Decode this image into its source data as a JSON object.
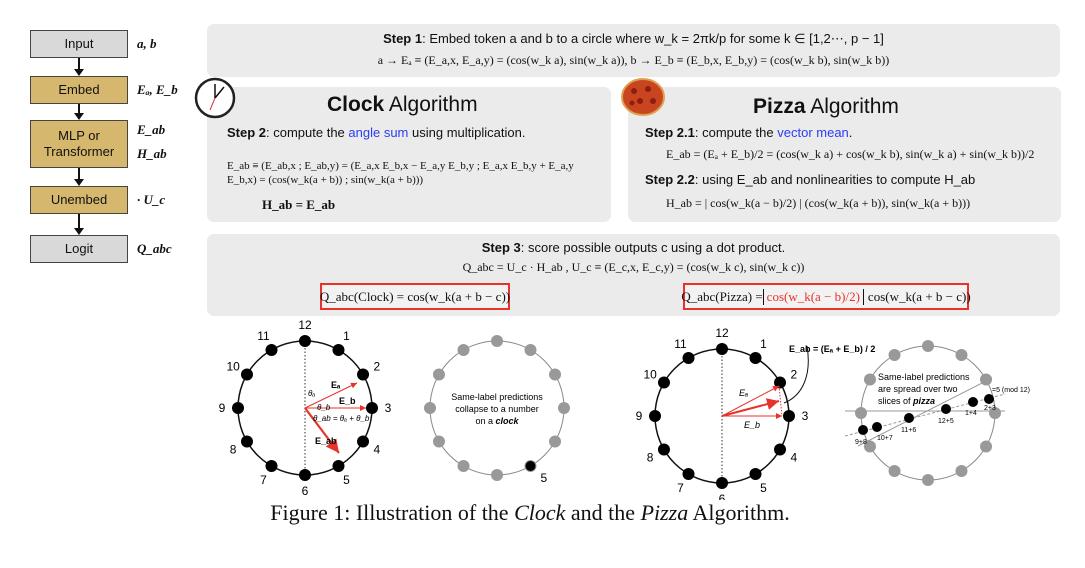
{
  "flowchart": {
    "boxes": [
      {
        "label": "Input",
        "color": "#d9d9d9"
      },
      {
        "label": "Embed",
        "color": "#d5b86e"
      },
      {
        "label": "MLP or Transformer",
        "color": "#d5b86e"
      },
      {
        "label": "Unembed",
        "color": "#d5b86e"
      },
      {
        "label": "Logit",
        "color": "#d9d9d9"
      }
    ],
    "side_labels": [
      "a, b",
      "Eₐ, E_b",
      "E_ab",
      "H_ab",
      "· U_c",
      "Q_abc"
    ]
  },
  "step1": {
    "bold": "Step 1",
    "text": ": Embed token a and b to a circle where w_k = 2πk/p for some k ∈ [1,2⋯, p − 1]",
    "formula": "a → Eₐ ≡ (E_a,x, E_a,y) = (cos(w_k a), sin(w_k a)), b → E_b ≡ (E_b,x, E_b,y) = (cos(w_k b), sin(w_k b))"
  },
  "clock": {
    "title_bold": "Clock",
    "title_rest": " Algorithm",
    "step_bold": "Step 2",
    "step_pre": ": compute the ",
    "step_highlight": "angle sum",
    "step_post": " using multiplication.",
    "formula": "E_ab ≡ (E_ab,x ; E_ab,y) = (E_a,x E_b,x − E_a,y E_b,y ; E_a,x E_b,y + E_a,y E_b,x) = (cos(w_k(a + b)) ; sin(w_k(a + b)))",
    "formula2": "H_ab = E_ab",
    "icon": "clock-icon"
  },
  "pizza": {
    "title_bold": "Pizza",
    "title_rest": " Algorithm",
    "step21_bold": "Step 2.1",
    "step21_pre": ": compute the ",
    "step21_highlight": "vector mean",
    "step21_post": ".",
    "formula1": "E_ab = (Eₐ + E_b)/2 = (cos(w_k a) + cos(w_k b), sin(w_k a) + sin(w_k b))/2",
    "step22_bold": "Step 2.2",
    "step22_text": ": using E_ab and nonlinearities to compute H_ab",
    "formula2": "H_ab = | cos(w_k(a − b)/2) | (cos(w_k(a + b)), sin(w_k(a + b)))",
    "icon": "pizza-icon"
  },
  "step3": {
    "bold": "Step 3",
    "text": ": score possible outputs c using a dot product.",
    "formula": "Q_abc = U_c · H_ab ,  U_c ≡ (E_c,x, E_c,y) = (cos(w_k c), sin(w_k c))",
    "clock_box": "Q_abc(Clock) = cos(w_k(a + b − c))",
    "pizza_box_pre": "Q_abc(Pizza) = ",
    "pizza_box_red": "cos(w_k(a − b)/2)",
    "pizza_box_post": "cos(w_k(a + b − c))"
  },
  "diagrams": {
    "hours": [
      "12",
      "1",
      "2",
      "3",
      "4",
      "5",
      "6",
      "7",
      "8",
      "9",
      "10",
      "11"
    ],
    "clock_vectors": {
      "ea": "Eₐ",
      "eb": "E_b",
      "eab": "E_ab",
      "theta_a": "θₐ",
      "theta_b": "θ_b",
      "theta_sum": "θ_ab = θₐ + θ_b"
    },
    "clock_collapse": {
      "line1": "Same-label predictions",
      "line2": "collapse to a number",
      "line3_pre": "on a ",
      "line3_em": "clock",
      "highlight": "5"
    },
    "pizza_vectors": {
      "ea": "Eₐ",
      "eb": "E_b",
      "eab": "E_ab = (Eₐ + E_b) / 2"
    },
    "pizza_spread": {
      "line1": "Same-label predictions",
      "line2": "are spread over two",
      "line3_pre": "slices of ",
      "line3_em": "pizza",
      "mod": "=5 (mod 12)",
      "points": [
        "9+8",
        "10+7",
        "11+6",
        "12+5",
        "1+4",
        "2+3"
      ]
    },
    "accent": "#e8332a"
  },
  "caption": {
    "pre": "Figure 1: Illustration of the ",
    "clock": "Clock",
    "mid": " and the ",
    "pizza": "Pizza",
    "post": " Algorithm."
  }
}
